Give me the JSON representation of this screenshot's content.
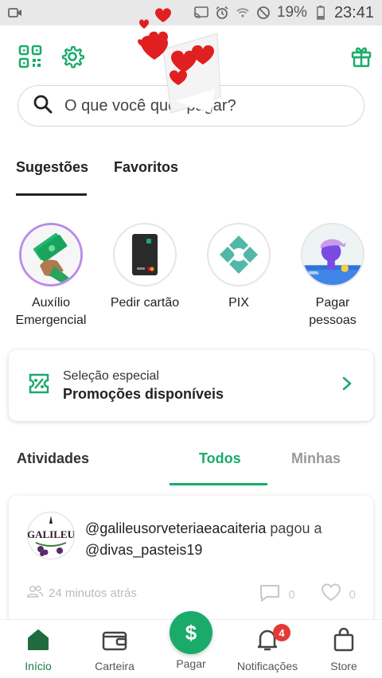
{
  "status_bar": {
    "battery": "19%",
    "time": "23:41"
  },
  "search": {
    "placeholder": "O que você quer pagar?"
  },
  "tabs": {
    "suggestions": "Sugestões",
    "favorites": "Favoritos"
  },
  "suggestions": [
    {
      "label_line1": "Auxílio",
      "label_line2": "Emergencial"
    },
    {
      "label_line1": "Pedir cartão",
      "label_line2": ""
    },
    {
      "label_line1": "PIX",
      "label_line2": ""
    },
    {
      "label_line1": "Pagar",
      "label_line2": "pessoas"
    }
  ],
  "promo": {
    "subtitle": "Seleção especial",
    "title": "Promoções disponíveis"
  },
  "activities": {
    "title": "Atividades",
    "tab_all": "Todos",
    "tab_mine": "Minhas"
  },
  "feed": {
    "actor": "@galileusorveteriaeacaiteria",
    "action": "pagou a",
    "target": "@divas_pasteis19",
    "time": "24 minutos atrás",
    "comments": "0",
    "likes": "0",
    "avatar_text": "GALILEU"
  },
  "nav": {
    "home": "Início",
    "wallet": "Carteira",
    "pay": "Pagar",
    "notifications": "Notificações",
    "notifications_badge": "4",
    "store": "Store"
  },
  "colors": {
    "brand_green": "#1aab6a",
    "badge_red": "#e53935"
  }
}
